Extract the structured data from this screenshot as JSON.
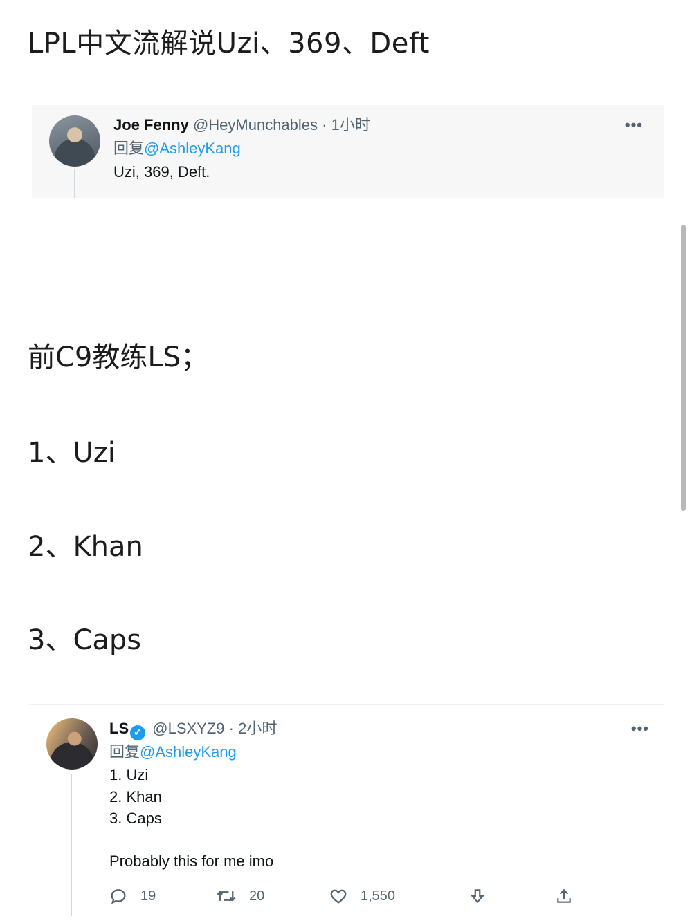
{
  "article": {
    "heading1": "LPL中文流解说Uzi、369、Deft",
    "heading2": "前C9教练LS；",
    "list": [
      "1、Uzi",
      "2、Khan",
      "3、Caps"
    ]
  },
  "tweet1": {
    "author_name": "Joe Fenny",
    "handle": "@HeyMunchables",
    "separator": "·",
    "time": "1小时",
    "reply_prefix": "回复",
    "reply_to": "@AshleyKang",
    "text": "Uzi, 369, Deft.",
    "more_label": "•••"
  },
  "tweet2": {
    "author_name": "LS",
    "verified_mark": "✓",
    "handle": "@LSXYZ9",
    "separator": "·",
    "time": "2小时",
    "reply_prefix": "回复",
    "reply_to": "@AshleyKang",
    "lines": [
      "1. Uzi",
      "2. Khan",
      "3. Caps"
    ],
    "text": "Probably this for me imo",
    "more_label": "•••",
    "actions": {
      "replies": "19",
      "retweets": "20",
      "likes": "1,550"
    }
  },
  "colors": {
    "link_blue": "#1d9bf0",
    "muted_gray": "#536471",
    "tweet_bg": "#f7f7f7"
  },
  "icons": [
    "reply-icon",
    "retweet-icon",
    "like-icon",
    "save-icon",
    "share-icon",
    "verified-badge-icon",
    "more-icon"
  ]
}
